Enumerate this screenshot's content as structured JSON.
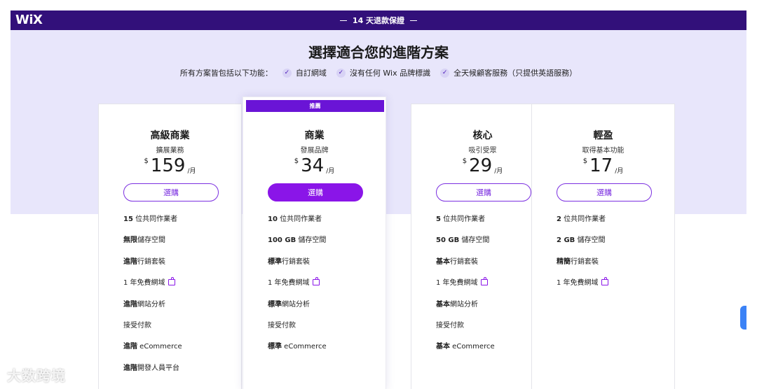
{
  "header": {
    "logo": "WiX",
    "guarantee": "14 天退款保證"
  },
  "hero": {
    "title": "選擇適合您的進階方案",
    "features_intro": "所有方案皆包括以下功能：",
    "features": [
      "自訂網域",
      "沒有任何 Wix 品牌標識",
      "全天候顧客服務（只提供英語服務）"
    ]
  },
  "plans": [
    {
      "name": "高級商業",
      "subtitle": "擴展業務",
      "currency": "$",
      "price": "159",
      "period": "/月",
      "button": "選購",
      "recommended": false,
      "items": [
        {
          "bold": "15",
          "text": " 位共同作業者",
          "gift": false
        },
        {
          "bold": "無限",
          "text": "儲存空間",
          "gift": false
        },
        {
          "bold": "進階",
          "text": "行銷套裝",
          "gift": false
        },
        {
          "bold": "",
          "text": "1 年免費網域",
          "gift": true
        },
        {
          "bold": "進階",
          "text": "網站分析",
          "gift": false
        },
        {
          "bold": "",
          "text": "接受付款",
          "gift": false
        },
        {
          "bold": "進階",
          "text": " eCommerce",
          "gift": false
        },
        {
          "bold": "進階",
          "text": "開發人員平台",
          "gift": false
        }
      ]
    },
    {
      "name": "商業",
      "subtitle": "發展品牌",
      "currency": "$",
      "price": "34",
      "period": "/月",
      "button": "選購",
      "recommended": true,
      "badge": "推薦",
      "items": [
        {
          "bold": "10",
          "text": " 位共同作業者",
          "gift": false
        },
        {
          "bold": "100 GB",
          "text": " 儲存空間",
          "gift": false
        },
        {
          "bold": "標準",
          "text": "行銷套裝",
          "gift": false
        },
        {
          "bold": "",
          "text": "1 年免費網域",
          "gift": true
        },
        {
          "bold": "標準",
          "text": "網站分析",
          "gift": false
        },
        {
          "bold": "",
          "text": "接受付款",
          "gift": false
        },
        {
          "bold": "標準",
          "text": " eCommerce",
          "gift": false
        }
      ]
    },
    {
      "name": "核心",
      "subtitle": "吸引受眾",
      "currency": "$",
      "price": "29",
      "period": "/月",
      "button": "選購",
      "recommended": false,
      "items": [
        {
          "bold": "5",
          "text": " 位共同作業者",
          "gift": false
        },
        {
          "bold": "50 GB",
          "text": " 儲存空間",
          "gift": false
        },
        {
          "bold": "基本",
          "text": "行銷套裝",
          "gift": false
        },
        {
          "bold": "",
          "text": "1 年免費網域",
          "gift": true
        },
        {
          "bold": "基本",
          "text": "網站分析",
          "gift": false
        },
        {
          "bold": "",
          "text": "接受付款",
          "gift": false
        },
        {
          "bold": "基本",
          "text": " eCommerce",
          "gift": false
        }
      ]
    },
    {
      "name": "輕盈",
      "subtitle": "取得基本功能",
      "currency": "$",
      "price": "17",
      "period": "/月",
      "button": "選購",
      "recommended": false,
      "items": [
        {
          "bold": "2",
          "text": " 位共同作業者",
          "gift": false
        },
        {
          "bold": "2 GB",
          "text": " 儲存空間",
          "gift": false
        },
        {
          "bold": "精簡",
          "text": "行銷套裝",
          "gift": false
        },
        {
          "bold": "",
          "text": "1 年免費網域",
          "gift": true
        }
      ]
    }
  ],
  "watermark": "大数跨境",
  "colors": {
    "topbar": "#32107a",
    "hero": "#e8e6fb",
    "accent": "#8a15e8"
  }
}
